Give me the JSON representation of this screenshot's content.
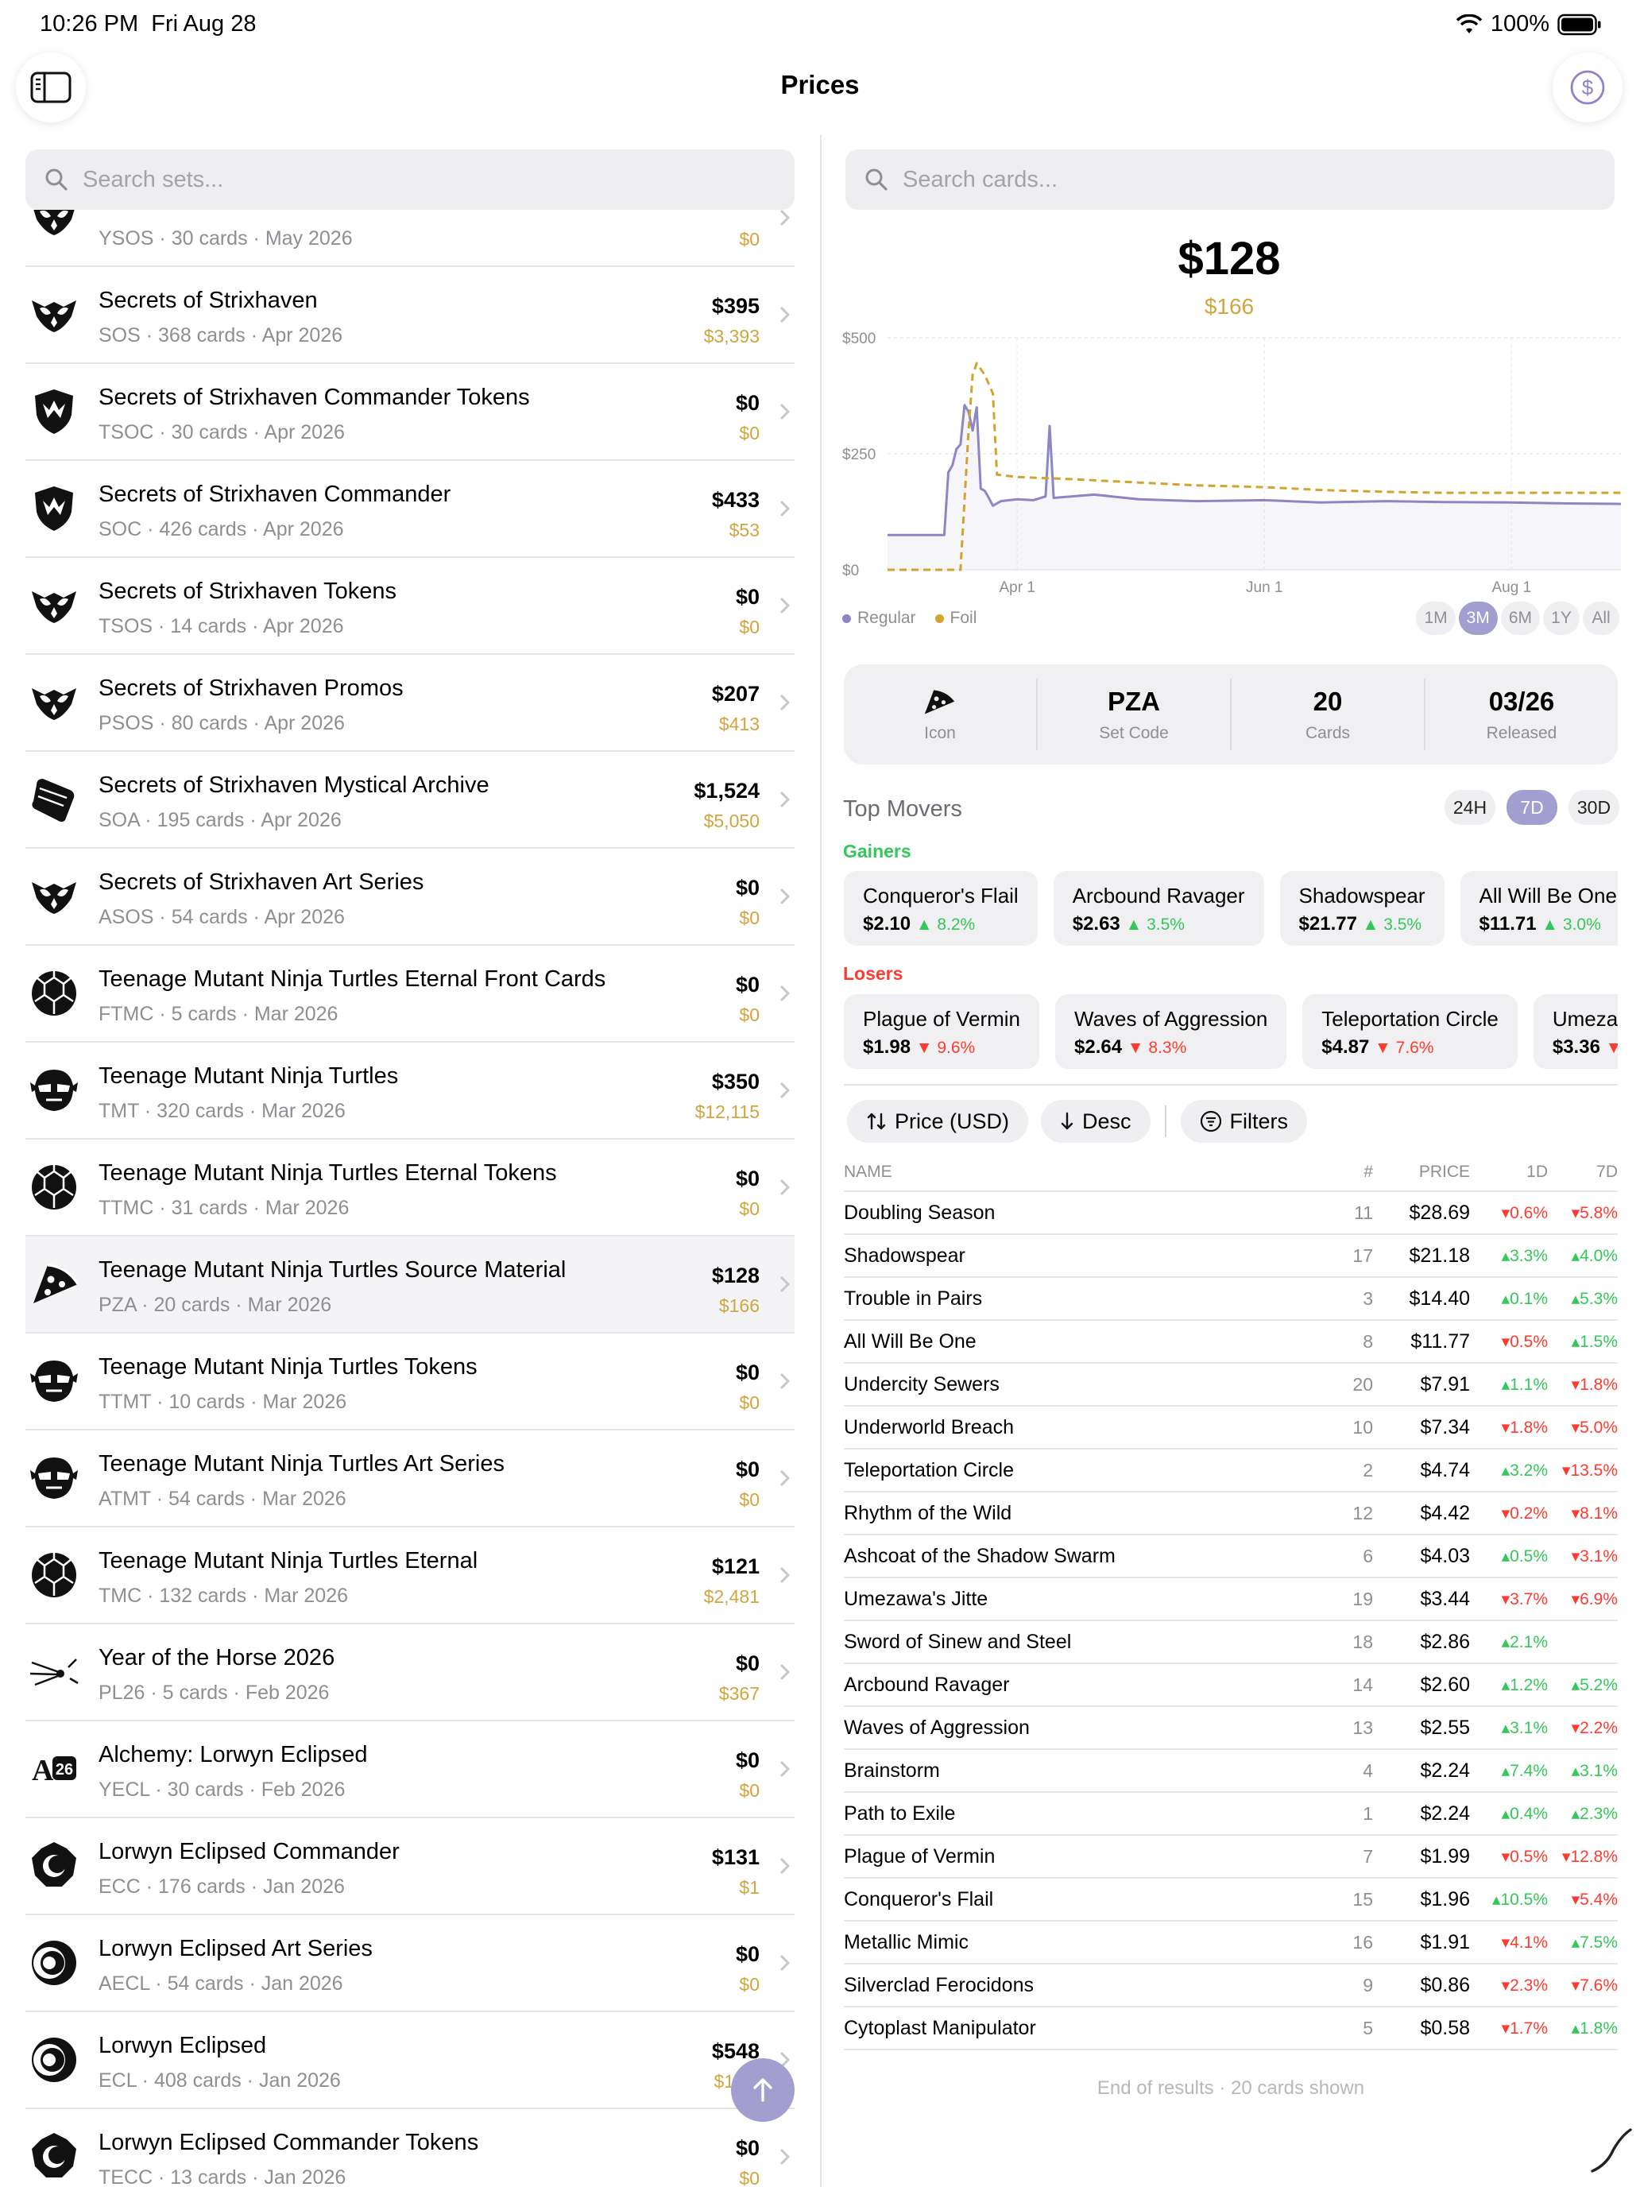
{
  "status": {
    "time": "10:26 PM",
    "date": "Fri Aug 28",
    "battery": "100%"
  },
  "nav": {
    "title": "Prices"
  },
  "search": {
    "sets_placeholder": "Search sets...",
    "cards_placeholder": "Search cards..."
  },
  "sets": [
    {
      "name": "",
      "code": "YSOS",
      "cards": "30 cards",
      "date": "May 2026",
      "price": "",
      "foil": "$0",
      "icon": "strixhaven-owl-icon"
    },
    {
      "name": "Secrets of Strixhaven",
      "code": "SOS",
      "cards": "368 cards",
      "date": "Apr 2026",
      "price": "$395",
      "foil": "$3,393",
      "icon": "strixhaven-owl-icon"
    },
    {
      "name": "Secrets of Strixhaven Commander Tokens",
      "code": "TSOC",
      "cards": "30 cards",
      "date": "Apr 2026",
      "price": "$0",
      "foil": "$0",
      "icon": "commander-shield-icon"
    },
    {
      "name": "Secrets of Strixhaven Commander",
      "code": "SOC",
      "cards": "426 cards",
      "date": "Apr 2026",
      "price": "$433",
      "foil": "$53",
      "icon": "commander-shield-icon"
    },
    {
      "name": "Secrets of Strixhaven Tokens",
      "code": "TSOS",
      "cards": "14 cards",
      "date": "Apr 2026",
      "price": "$0",
      "foil": "$0",
      "icon": "strixhaven-owl-icon"
    },
    {
      "name": "Secrets of Strixhaven Promos",
      "code": "PSOS",
      "cards": "80 cards",
      "date": "Apr 2026",
      "price": "$207",
      "foil": "$413",
      "icon": "strixhaven-owl-icon"
    },
    {
      "name": "Secrets of Strixhaven Mystical Archive",
      "code": "SOA",
      "cards": "195 cards",
      "date": "Apr 2026",
      "price": "$1,524",
      "foil": "$5,050",
      "icon": "scroll-icon"
    },
    {
      "name": "Secrets of Strixhaven Art Series",
      "code": "ASOS",
      "cards": "54 cards",
      "date": "Apr 2026",
      "price": "$0",
      "foil": "$0",
      "icon": "strixhaven-owl-icon"
    },
    {
      "name": "Teenage Mutant Ninja Turtles Eternal Front Cards",
      "code": "FTMC",
      "cards": "5 cards",
      "date": "Mar 2026",
      "price": "$0",
      "foil": "$0",
      "icon": "turtle-shell-icon"
    },
    {
      "name": "Teenage Mutant Ninja Turtles",
      "code": "TMT",
      "cards": "320 cards",
      "date": "Mar 2026",
      "price": "$350",
      "foil": "$12,115",
      "icon": "ninja-mask-icon"
    },
    {
      "name": "Teenage Mutant Ninja Turtles Eternal Tokens",
      "code": "TTMC",
      "cards": "31 cards",
      "date": "Mar 2026",
      "price": "$0",
      "foil": "$0",
      "icon": "turtle-shell-icon"
    },
    {
      "name": "Teenage Mutant Ninja Turtles Source Material",
      "code": "PZA",
      "cards": "20 cards",
      "date": "Mar 2026",
      "price": "$128",
      "foil": "$166",
      "icon": "pizza-icon",
      "selected": true
    },
    {
      "name": "Teenage Mutant Ninja Turtles Tokens",
      "code": "TTMT",
      "cards": "10 cards",
      "date": "Mar 2026",
      "price": "$0",
      "foil": "$0",
      "icon": "ninja-mask-icon"
    },
    {
      "name": "Teenage Mutant Ninja Turtles Art Series",
      "code": "ATMT",
      "cards": "54 cards",
      "date": "Mar 2026",
      "price": "$0",
      "foil": "$0",
      "icon": "ninja-mask-icon"
    },
    {
      "name": "Teenage Mutant Ninja Turtles Eternal",
      "code": "TMC",
      "cards": "132 cards",
      "date": "Mar 2026",
      "price": "$121",
      "foil": "$2,481",
      "icon": "turtle-shell-icon"
    },
    {
      "name": "Year of the Horse 2026",
      "code": "PL26",
      "cards": "5 cards",
      "date": "Feb 2026",
      "price": "$0",
      "foil": "$367",
      "icon": "comet-icon"
    },
    {
      "name": "Alchemy: Lorwyn Eclipsed",
      "code": "YECL",
      "cards": "30 cards",
      "date": "Feb 2026",
      "price": "$0",
      "foil": "$0",
      "icon": "alchemy-a26-icon"
    },
    {
      "name": "Lorwyn Eclipsed Commander",
      "code": "ECC",
      "cards": "176 cards",
      "date": "Jan 2026",
      "price": "$131",
      "foil": "$1",
      "icon": "eclipse-shield-icon"
    },
    {
      "name": "Lorwyn Eclipsed Art Series",
      "code": "AECL",
      "cards": "54 cards",
      "date": "Jan 2026",
      "price": "$0",
      "foil": "$0",
      "icon": "eclipse-icon"
    },
    {
      "name": "Lorwyn Eclipsed",
      "code": "ECL",
      "cards": "408 cards",
      "date": "Jan 2026",
      "price": "$548",
      "foil": "$1,94",
      "icon": "eclipse-icon"
    },
    {
      "name": "Lorwyn Eclipsed Commander Tokens",
      "code": "TECC",
      "cards": "13 cards",
      "date": "Jan 2026",
      "price": "$0",
      "foil": "$0",
      "icon": "eclipse-shield-icon"
    }
  ],
  "detail": {
    "price": "$128",
    "foil_price": "$166",
    "legend": {
      "regular": "Regular",
      "foil": "Foil"
    },
    "ranges": [
      "1M",
      "3M",
      "6M",
      "1Y",
      "All"
    ],
    "active_range": "3M",
    "info": {
      "icon_label": "Icon",
      "set_code": "PZA",
      "set_code_label": "Set Code",
      "cards": "20",
      "cards_label": "Cards",
      "released": "03/26",
      "released_label": "Released"
    },
    "movers_title": "Top Movers",
    "mover_ranges": [
      "24H",
      "7D",
      "30D"
    ],
    "active_mover_range": "7D",
    "gainers_label": "Gainers",
    "losers_label": "Losers",
    "gainers": [
      {
        "name": "Conqueror's Flail",
        "price": "$2.10",
        "change": "8.2%"
      },
      {
        "name": "Arcbound Ravager",
        "price": "$2.63",
        "change": "3.5%"
      },
      {
        "name": "Shadowspear",
        "price": "$21.77",
        "change": "3.5%"
      },
      {
        "name": "All Will Be One",
        "price": "$11.71",
        "change": "3.0%"
      }
    ],
    "losers": [
      {
        "name": "Plague of Vermin",
        "price": "$1.98",
        "change": "9.6%"
      },
      {
        "name": "Waves of Aggression",
        "price": "$2.64",
        "change": "8.3%"
      },
      {
        "name": "Teleportation Circle",
        "price": "$4.87",
        "change": "7.6%"
      },
      {
        "name": "Umeza",
        "price": "$3.36",
        "change": ""
      }
    ],
    "sort": {
      "field": "Price (USD)",
      "order": "Desc",
      "filters": "Filters"
    },
    "table_headers": {
      "name": "NAME",
      "num": "#",
      "price": "PRICE",
      "d1": "1D",
      "d7": "7D"
    },
    "cards": [
      {
        "name": "Doubling Season",
        "num": "11",
        "price": "$28.69",
        "d1": "0.6%",
        "d1_dir": "down",
        "d7": "5.8%",
        "d7_dir": "down"
      },
      {
        "name": "Shadowspear",
        "num": "17",
        "price": "$21.18",
        "d1": "3.3%",
        "d1_dir": "up",
        "d7": "4.0%",
        "d7_dir": "up"
      },
      {
        "name": "Trouble in Pairs",
        "num": "3",
        "price": "$14.40",
        "d1": "0.1%",
        "d1_dir": "up",
        "d7": "5.3%",
        "d7_dir": "up"
      },
      {
        "name": "All Will Be One",
        "num": "8",
        "price": "$11.77",
        "d1": "0.5%",
        "d1_dir": "down",
        "d7": "1.5%",
        "d7_dir": "up"
      },
      {
        "name": "Undercity Sewers",
        "num": "20",
        "price": "$7.91",
        "d1": "1.1%",
        "d1_dir": "up",
        "d7": "1.8%",
        "d7_dir": "down"
      },
      {
        "name": "Underworld Breach",
        "num": "10",
        "price": "$7.34",
        "d1": "1.8%",
        "d1_dir": "down",
        "d7": "5.0%",
        "d7_dir": "down"
      },
      {
        "name": "Teleportation Circle",
        "num": "2",
        "price": "$4.74",
        "d1": "3.2%",
        "d1_dir": "up",
        "d7": "13.5%",
        "d7_dir": "down"
      },
      {
        "name": "Rhythm of the Wild",
        "num": "12",
        "price": "$4.42",
        "d1": "0.2%",
        "d1_dir": "down",
        "d7": "8.1%",
        "d7_dir": "down"
      },
      {
        "name": "Ashcoat of the Shadow Swarm",
        "num": "6",
        "price": "$4.03",
        "d1": "0.5%",
        "d1_dir": "up",
        "d7": "3.1%",
        "d7_dir": "down"
      },
      {
        "name": "Umezawa's Jitte",
        "num": "19",
        "price": "$3.44",
        "d1": "3.7%",
        "d1_dir": "down",
        "d7": "6.9%",
        "d7_dir": "down"
      },
      {
        "name": "Sword of Sinew and Steel",
        "num": "18",
        "price": "$2.86",
        "d1": "2.1%",
        "d1_dir": "up",
        "d7": "",
        "d7_dir": ""
      },
      {
        "name": "Arcbound Ravager",
        "num": "14",
        "price": "$2.60",
        "d1": "1.2%",
        "d1_dir": "up",
        "d7": "5.2%",
        "d7_dir": "up"
      },
      {
        "name": "Waves of Aggression",
        "num": "13",
        "price": "$2.55",
        "d1": "3.1%",
        "d1_dir": "up",
        "d7": "2.2%",
        "d7_dir": "down"
      },
      {
        "name": "Brainstorm",
        "num": "4",
        "price": "$2.24",
        "d1": "7.4%",
        "d1_dir": "up",
        "d7": "3.1%",
        "d7_dir": "up"
      },
      {
        "name": "Path to Exile",
        "num": "1",
        "price": "$2.24",
        "d1": "0.4%",
        "d1_dir": "up",
        "d7": "2.3%",
        "d7_dir": "up"
      },
      {
        "name": "Plague of Vermin",
        "num": "7",
        "price": "$1.99",
        "d1": "0.5%",
        "d1_dir": "down",
        "d7": "12.8%",
        "d7_dir": "down"
      },
      {
        "name": "Conqueror's Flail",
        "num": "15",
        "price": "$1.96",
        "d1": "10.5%",
        "d1_dir": "up",
        "d7": "5.4%",
        "d7_dir": "down"
      },
      {
        "name": "Metallic Mimic",
        "num": "16",
        "price": "$1.91",
        "d1": "4.1%",
        "d1_dir": "down",
        "d7": "7.5%",
        "d7_dir": "up"
      },
      {
        "name": "Silverclad Ferocidons",
        "num": "9",
        "price": "$0.86",
        "d1": "2.3%",
        "d1_dir": "down",
        "d7": "7.6%",
        "d7_dir": "down"
      },
      {
        "name": "Cytoplast Manipulator",
        "num": "5",
        "price": "$0.58",
        "d1": "1.7%",
        "d1_dir": "down",
        "d7": "1.8%",
        "d7_dir": "up"
      }
    ],
    "footer": "End of results · 20 cards shown"
  },
  "colors": {
    "accent": "#a29ed0",
    "regular": "#8c87c4",
    "foil": "#d4a32f",
    "up": "#34c759",
    "down": "#ff3b30"
  },
  "chart_data": {
    "type": "line",
    "title": "",
    "xlabel": "",
    "ylabel": "",
    "y_ticks": [
      "$500",
      "$250",
      "$0"
    ],
    "x_ticks": [
      "Apr 1",
      "Jun 1",
      "Aug 1"
    ],
    "ylim": [
      0,
      500
    ],
    "xlim": [
      "2026-02-28",
      "2026-08-28"
    ],
    "grid": true,
    "legend": "bottom-left",
    "series": [
      {
        "name": "Regular",
        "color": "#8c87c4",
        "points": [
          [
            "2026-02-28",
            75
          ],
          [
            "2026-03-14",
            75
          ],
          [
            "2026-03-15",
            210
          ],
          [
            "2026-03-16",
            225
          ],
          [
            "2026-03-17",
            260
          ],
          [
            "2026-03-18",
            270
          ],
          [
            "2026-03-19",
            355
          ],
          [
            "2026-03-20",
            340
          ],
          [
            "2026-03-21",
            300
          ],
          [
            "2026-03-22",
            350
          ],
          [
            "2026-03-23",
            175
          ],
          [
            "2026-03-24",
            170
          ],
          [
            "2026-03-25",
            155
          ],
          [
            "2026-03-26",
            138
          ],
          [
            "2026-03-28",
            148
          ],
          [
            "2026-04-01",
            152
          ],
          [
            "2026-04-05",
            150
          ],
          [
            "2026-04-08",
            158
          ],
          [
            "2026-04-09",
            310
          ],
          [
            "2026-04-10",
            155
          ],
          [
            "2026-04-20",
            162
          ],
          [
            "2026-05-01",
            152
          ],
          [
            "2026-05-15",
            148
          ],
          [
            "2026-06-01",
            150
          ],
          [
            "2026-06-15",
            145
          ],
          [
            "2026-07-01",
            148
          ],
          [
            "2026-07-15",
            146
          ],
          [
            "2026-08-01",
            145
          ],
          [
            "2026-08-15",
            143
          ],
          [
            "2026-08-28",
            142
          ]
        ]
      },
      {
        "name": "Foil",
        "color": "#d4a32f",
        "points": [
          [
            "2026-02-28",
            0
          ],
          [
            "2026-03-18",
            0
          ],
          [
            "2026-03-19",
            150
          ],
          [
            "2026-03-20",
            300
          ],
          [
            "2026-03-21",
            420
          ],
          [
            "2026-03-22",
            445
          ],
          [
            "2026-03-24",
            420
          ],
          [
            "2026-03-26",
            380
          ],
          [
            "2026-03-27",
            205
          ],
          [
            "2026-04-01",
            200
          ],
          [
            "2026-04-15",
            195
          ],
          [
            "2026-05-01",
            188
          ],
          [
            "2026-05-15",
            182
          ],
          [
            "2026-06-01",
            178
          ],
          [
            "2026-06-15",
            172
          ],
          [
            "2026-07-01",
            168
          ],
          [
            "2026-07-15",
            166
          ],
          [
            "2026-08-01",
            166
          ],
          [
            "2026-08-15",
            166
          ],
          [
            "2026-08-28",
            166
          ]
        ]
      }
    ]
  }
}
